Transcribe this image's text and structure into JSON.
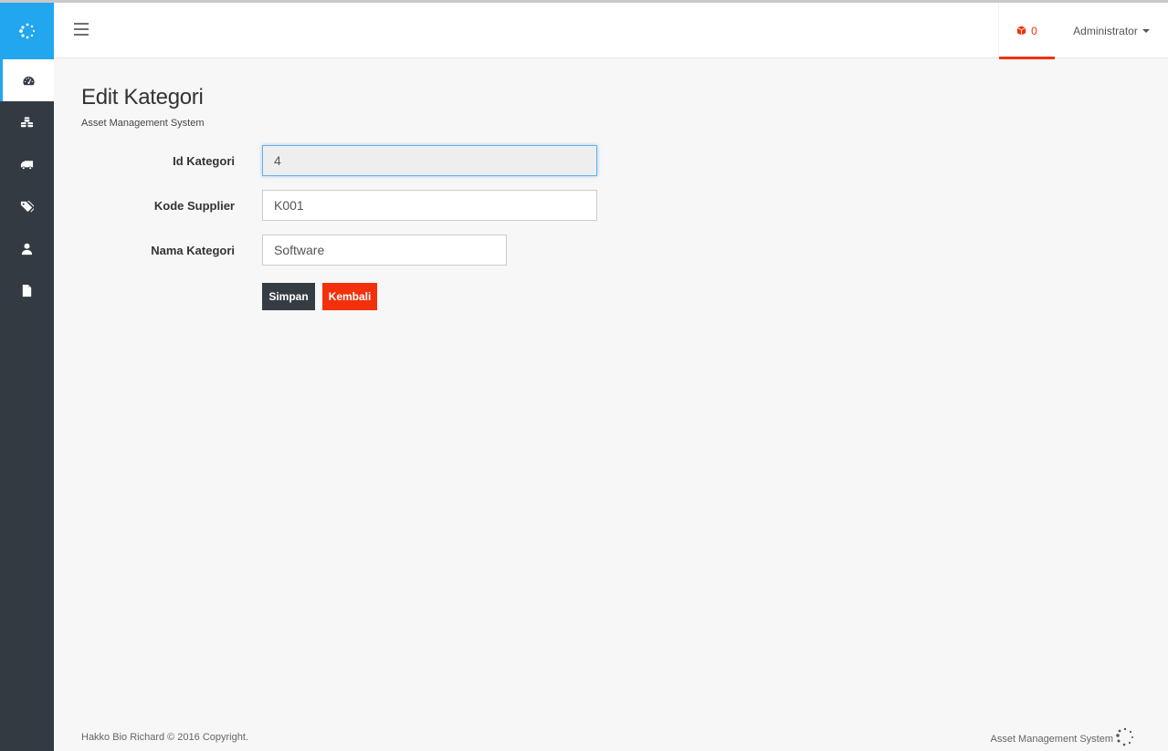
{
  "sidebar": {
    "logo_icon": "spinner-dots-icon",
    "items": [
      {
        "name": "dashboard",
        "icon": "dashboard-icon",
        "active": true
      },
      {
        "name": "assets",
        "icon": "cubes-icon",
        "active": false
      },
      {
        "name": "suppliers",
        "icon": "truck-icon",
        "active": false
      },
      {
        "name": "categories",
        "icon": "tags-icon",
        "active": false
      },
      {
        "name": "users",
        "icon": "user-icon",
        "active": false
      },
      {
        "name": "reports",
        "icon": "file-icon",
        "active": false
      }
    ]
  },
  "topbar": {
    "menu_icon": "hamburger-icon",
    "notification": {
      "icon": "cube-icon",
      "count": "0"
    },
    "user": {
      "label": "Administrator"
    }
  },
  "page": {
    "title": "Edit Kategori",
    "subtitle": "Asset Management System"
  },
  "form": {
    "fields": [
      {
        "label": "Id Kategori",
        "value": "4",
        "readonly": true
      },
      {
        "label": "Kode Supplier",
        "value": "K001",
        "readonly": false
      },
      {
        "label": "Nama Kategori",
        "value": "Software",
        "readonly": false
      }
    ],
    "save_label": "Simpan",
    "back_label": "Kembali"
  },
  "footer": {
    "copyright": "Hakko Bio Richard © 2016 Copyright.",
    "app_name": "Asset Management System"
  },
  "colors": {
    "accent_blue": "#22a7ee",
    "accent_red": "#f2310c",
    "sidebar_dark": "#333a42"
  }
}
